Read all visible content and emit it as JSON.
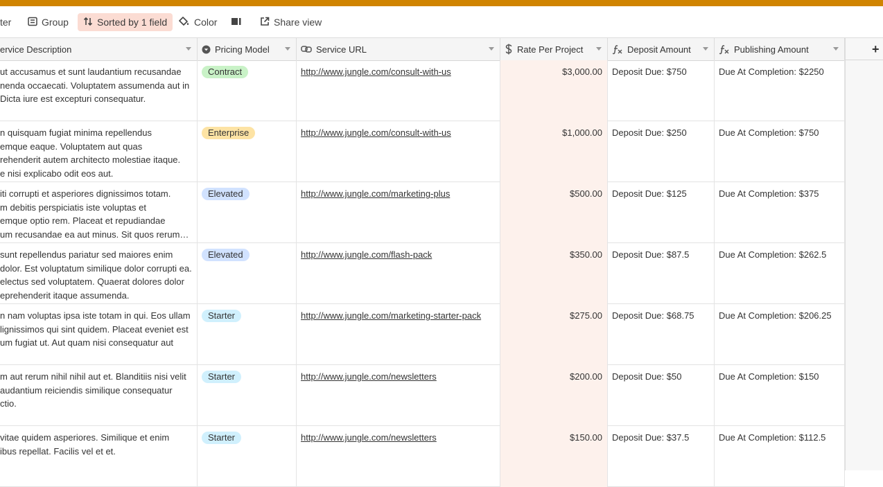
{
  "toolbar": {
    "filter_label": "ter",
    "group_label": "Group",
    "sort_label": "Sorted by 1 field",
    "color_label": "Color",
    "share_label": "Share view"
  },
  "columns": {
    "description": "ervice Description",
    "pricing_model": "Pricing Model",
    "service_url": "Service URL",
    "rate": "Rate Per Project",
    "deposit": "Deposit Amount",
    "publishing": "Publishing Amount"
  },
  "add_field_label": "+",
  "colors": {
    "accent_bar": "#d08400",
    "sort_highlight": "#fbdcd3",
    "rate_column_bg": "#fdf1ec",
    "pill_contract": "#c9f2c7",
    "pill_enterprise": "#fde3a4",
    "pill_elevated": "#d1e2ff",
    "pill_starter": "#d0f0fd"
  },
  "icons": {
    "group": "group-icon",
    "sort": "sort-arrows-icon",
    "color": "paint-bucket-icon",
    "row_height": "row-height-icon",
    "share": "share-icon",
    "single_select": "single-select-icon",
    "url": "link-icon",
    "currency": "currency-icon",
    "formula": "formula-icon"
  },
  "rows": [
    {
      "description": "ut accusamus et sunt laudantium recusandae\nnenda occaecati. Voluptatem assumenda aut in\nDicta iure est excepturi consequatur.",
      "pricing_model": "Contract",
      "pill_color": "#c9f2c7",
      "service_url": "http://www.jungle.com/consult-with-us",
      "rate": "$3,000.00",
      "deposit": "Deposit Due: $750",
      "publishing": "Due At Completion: $2250"
    },
    {
      "description": "n quisquam fugiat minima repellendus\nemque eaque. Voluptatem aut quas\nrehenderit autem architecto molestiae itaque.\ne nisi explicabo odit eos aut.",
      "pricing_model": "Enterprise",
      "pill_color": "#fde3a4",
      "service_url": "http://www.jungle.com/consult-with-us",
      "rate": "$1,000.00",
      "deposit": "Deposit Due: $250",
      "publishing": "Due At Completion: $750"
    },
    {
      "description": "iti corrupti et asperiores dignissimos totam.\nm debitis perspiciatis iste voluptas et\nemque optio rem. Placeat et repudiandae\num recusandae ea aut minus. Sit quos rerum et...",
      "pricing_model": "Elevated",
      "pill_color": "#d1e2ff",
      "service_url": "http://www.jungle.com/marketing-plus",
      "rate": "$500.00",
      "deposit": "Deposit Due: $125",
      "publishing": "Due At Completion: $375"
    },
    {
      "description": " sunt repellendus pariatur sed maiores enim\ndolor. Est voluptatum similique dolor corrupti ea.\nelectus sed voluptatem. Quaerat dolores dolor\neprehenderit itaque assumenda.",
      "pricing_model": "Elevated",
      "pill_color": "#d1e2ff",
      "service_url": "http://www.jungle.com/flash-pack",
      "rate": "$350.00",
      "deposit": "Deposit Due: $87.5",
      "publishing": "Due At Completion: $262.5"
    },
    {
      "description": "n nam voluptas ipsa iste totam in qui. Eos ullam\nlignissimos qui sint quidem. Placeat eveniet est\num fugiat ut. Aut quam nisi consequatur aut",
      "pricing_model": "Starter",
      "pill_color": "#d0f0fd",
      "service_url": "http://www.jungle.com/marketing-starter-pack",
      "rate": "$275.00",
      "deposit": "Deposit Due: $68.75",
      "publishing": "Due At Completion: $206.25"
    },
    {
      "description": "m aut rerum nihil nihil aut et. Blanditiis nisi velit\naudantium reiciendis similique consequatur\nctio.",
      "pricing_model": "Starter",
      "pill_color": "#d0f0fd",
      "service_url": "http://www.jungle.com/newsletters",
      "rate": "$200.00",
      "deposit": "Deposit Due: $50",
      "publishing": "Due At Completion: $150"
    },
    {
      "description": "vitae quidem asperiores. Similique et enim\nibus repellat. Facilis vel et et.",
      "pricing_model": "Starter",
      "pill_color": "#d0f0fd",
      "service_url": "http://www.jungle.com/newsletters",
      "rate": "$150.00",
      "deposit": "Deposit Due: $37.5",
      "publishing": "Due At Completion: $112.5"
    }
  ]
}
